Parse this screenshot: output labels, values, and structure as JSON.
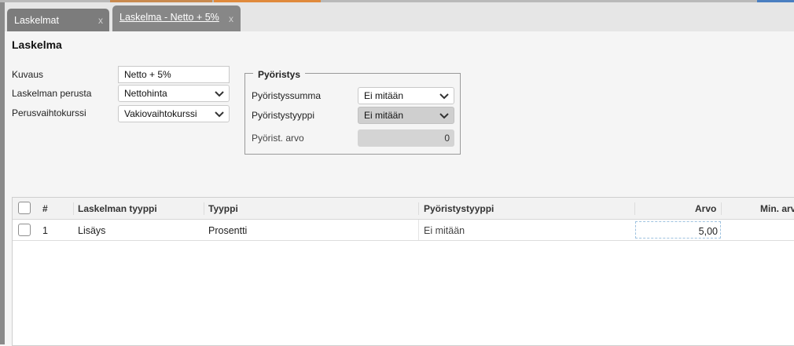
{
  "colors": {
    "topbar_segments": [
      "#b9b9b9",
      "#e08a3c",
      "#b9b9b9",
      "#4a7fc1"
    ],
    "active_tab_bg": "#878787",
    "inactive_tab_bg": "#7c7c7c",
    "edit_cell_border": "#9fc3e0"
  },
  "tabs": [
    {
      "label": "Laskelmat",
      "close": "x"
    },
    {
      "label": "Laskelma - Netto + 5%",
      "close": "x"
    }
  ],
  "form": {
    "title": "Laskelma",
    "kuvaus_label": "Kuvaus",
    "kuvaus_value": "Netto + 5%",
    "perusta_label": "Laskelman perusta",
    "perusta_value": "Nettohinta",
    "vaihtokurssi_label": "Perusvaihtokurssi",
    "vaihtokurssi_value": "Vakiovaihtokurssi"
  },
  "rounding": {
    "legend": "Pyöristys",
    "summa_label": "Pyöristyssumma",
    "summa_value": "Ei mitään",
    "tyyppi_label": "Pyöristystyyppi",
    "tyyppi_value": "Ei mitään",
    "arvo_label": "Pyörist. arvo",
    "arvo_value": "0"
  },
  "grid": {
    "columns": [
      "#",
      "Laskelman tyyppi",
      "Tyyppi",
      "Pyöristystyyppi",
      "Arvo",
      "Min. arvo"
    ],
    "rows": [
      {
        "num": "1",
        "laskelman_tyyppi": "Lisäys",
        "tyyppi": "Prosentti",
        "pyoristystyyppi": "Ei mitään",
        "arvo": "5,00",
        "min_arvo": ""
      }
    ]
  },
  "icons": {
    "chevron": "chevron-down-icon",
    "checkbox": "checkbox-icon"
  }
}
